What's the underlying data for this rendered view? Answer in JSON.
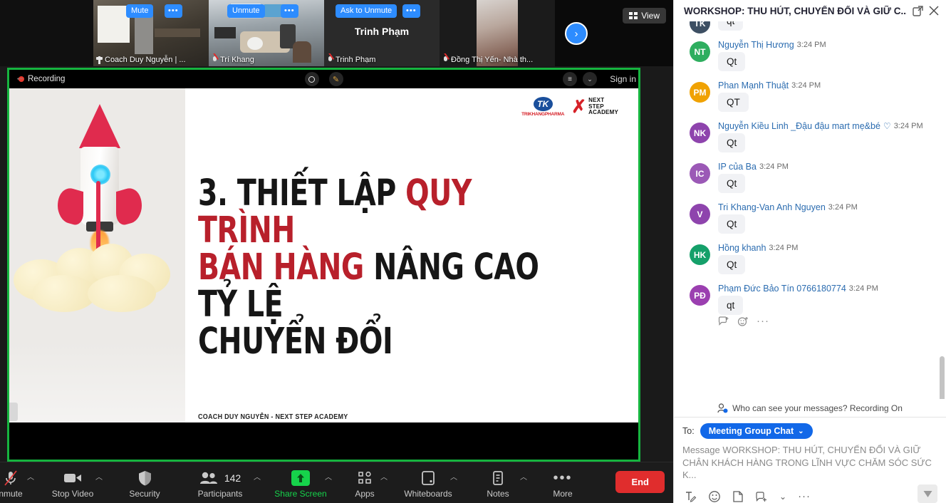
{
  "filmstrip": {
    "tiles": [
      {
        "name": "Coach Duy Nguyễn | ...",
        "button": "Mute",
        "dots": "•••",
        "active": true,
        "muted": false,
        "pinned": true,
        "center_name": ""
      },
      {
        "name": "Trí Khang",
        "button": "Unmute",
        "dots": "•••",
        "active": false,
        "muted": true,
        "pinned": false,
        "center_name": ""
      },
      {
        "name": "Trinh Phạm",
        "button": "Ask to Unmute",
        "dots": "•••",
        "active": false,
        "muted": true,
        "pinned": false,
        "center_name": "Trinh Phạm"
      },
      {
        "name": "Đồng Thị Yến- Nhà th...",
        "button": "",
        "dots": "",
        "active": false,
        "muted": true,
        "pinned": false,
        "center_name": ""
      }
    ],
    "next_arrow": "›",
    "view_label": "View"
  },
  "share": {
    "recording_label": "Recording",
    "sign_in_label": "Sign in",
    "slide": {
      "title_parts": [
        {
          "text": "3. THIẾT LẬP ",
          "color": "black"
        },
        {
          "text": "QUY TRÌNH",
          "color": "red"
        },
        {
          "text": " ",
          "color": "black"
        },
        {
          "text": "BÁN HÀNG",
          "color": "red"
        },
        {
          "text": " NÂNG CAO TỶ LỆ CHUYỂN ĐỔI",
          "color": "black"
        }
      ],
      "title_line1_black": "3. THIẾT LẬP ",
      "title_line1_red": "QUY TRÌNH",
      "title_line2_red": "BÁN HÀNG",
      "title_line2_black": " NÂNG CAO TỶ LỆ",
      "title_line3": "CHUYỂN ĐỔI",
      "footer": "COACH DUY NGUYỄN - NEXT STEP ACADEMY",
      "logo_tk_mark": "TK",
      "logo_tk_word": "TRIKHANGPHARMA",
      "logo_ns_line1": "NEXT",
      "logo_ns_line2": "STEP",
      "logo_ns_line3": "ACADEMY"
    }
  },
  "toolbar": {
    "items": [
      {
        "label": "nmute",
        "name": "unmute",
        "icon": "mic-off-icon",
        "caret": true,
        "highlight": false
      },
      {
        "label": "Stop Video",
        "name": "stop-video",
        "icon": "video-icon",
        "caret": true,
        "highlight": false
      },
      {
        "label": "Security",
        "name": "security",
        "icon": "shield-icon",
        "caret": false,
        "highlight": false
      },
      {
        "label": "Participants",
        "name": "participants",
        "icon": "people-icon",
        "caret": true,
        "highlight": false,
        "count": "142"
      },
      {
        "label": "Share Screen",
        "name": "share-screen",
        "icon": "share-up-icon",
        "caret": true,
        "highlight": true
      },
      {
        "label": "Apps",
        "name": "apps",
        "icon": "apps-icon",
        "caret": true,
        "highlight": false
      },
      {
        "label": "Whiteboards",
        "name": "whiteboards",
        "icon": "whiteboard-icon",
        "caret": true,
        "highlight": false
      },
      {
        "label": "Notes",
        "name": "notes",
        "icon": "notes-icon",
        "caret": true,
        "highlight": false
      },
      {
        "label": "More",
        "name": "more",
        "icon": "ellipsis-icon",
        "caret": false,
        "highlight": false
      }
    ],
    "end_label": "End",
    "share_color": "#16b43f",
    "end_color": "#e02d2d"
  },
  "chat": {
    "title": "WORKSHOP: THU HÚT, CHUYỂN ĐỔI VÀ GIỮ C...",
    "messages": [
      {
        "author": "",
        "time": "",
        "text": "qt",
        "initials": "TK",
        "color": "#3d4f63",
        "heart": false,
        "cut": true
      },
      {
        "author": "Nguyễn Thị Hương",
        "time": "3:24 PM",
        "text": "Qt",
        "initials": "NT",
        "color": "#2eae5f",
        "heart": false,
        "cut": false
      },
      {
        "author": "Phan Mạnh Thuật",
        "time": "3:24 PM",
        "text": "QT",
        "initials": "PM",
        "color": "#f0a202",
        "heart": false,
        "cut": false
      },
      {
        "author": "Nguyễn Kiều Linh _Đậu đậu mart mẹ&bé",
        "time": "3:24 PM",
        "text": "Qt",
        "initials": "NK",
        "color": "#8e44ad",
        "heart": true,
        "cut": false
      },
      {
        "author": "IP của Ba",
        "time": "3:24 PM",
        "text": "Qt",
        "initials": "IC",
        "color": "#9b59b6",
        "heart": false,
        "cut": false
      },
      {
        "author": "Tri Khang-Van Anh Nguyen",
        "time": "3:24 PM",
        "text": "Qt",
        "initials": "V",
        "color": "#8e44ad",
        "heart": false,
        "cut": false
      },
      {
        "author": "Hồng khanh",
        "time": "3:24 PM",
        "text": "Qt",
        "initials": "HK",
        "color": "#15a06a",
        "heart": false,
        "cut": false
      },
      {
        "author": "Phạm Đức Bảo Tín 0766180774",
        "time": "3:24 PM",
        "text": "qt",
        "initials": "PĐ",
        "color": "#9b3fb0",
        "heart": false,
        "cut": false
      }
    ],
    "who_can_see": "Who can see your messages? Recording On",
    "to_label": "To:",
    "to_value": "Meeting Group Chat",
    "message_placeholder": "Message WORKSHOP: THU HÚT, CHUYỂN ĐỔI VÀ GIỮ CHÂN KHÁCH HÀNG TRONG LĨNH VỰC CHĂM SÓC SỨC K...",
    "accent_color": "#1268e8"
  }
}
